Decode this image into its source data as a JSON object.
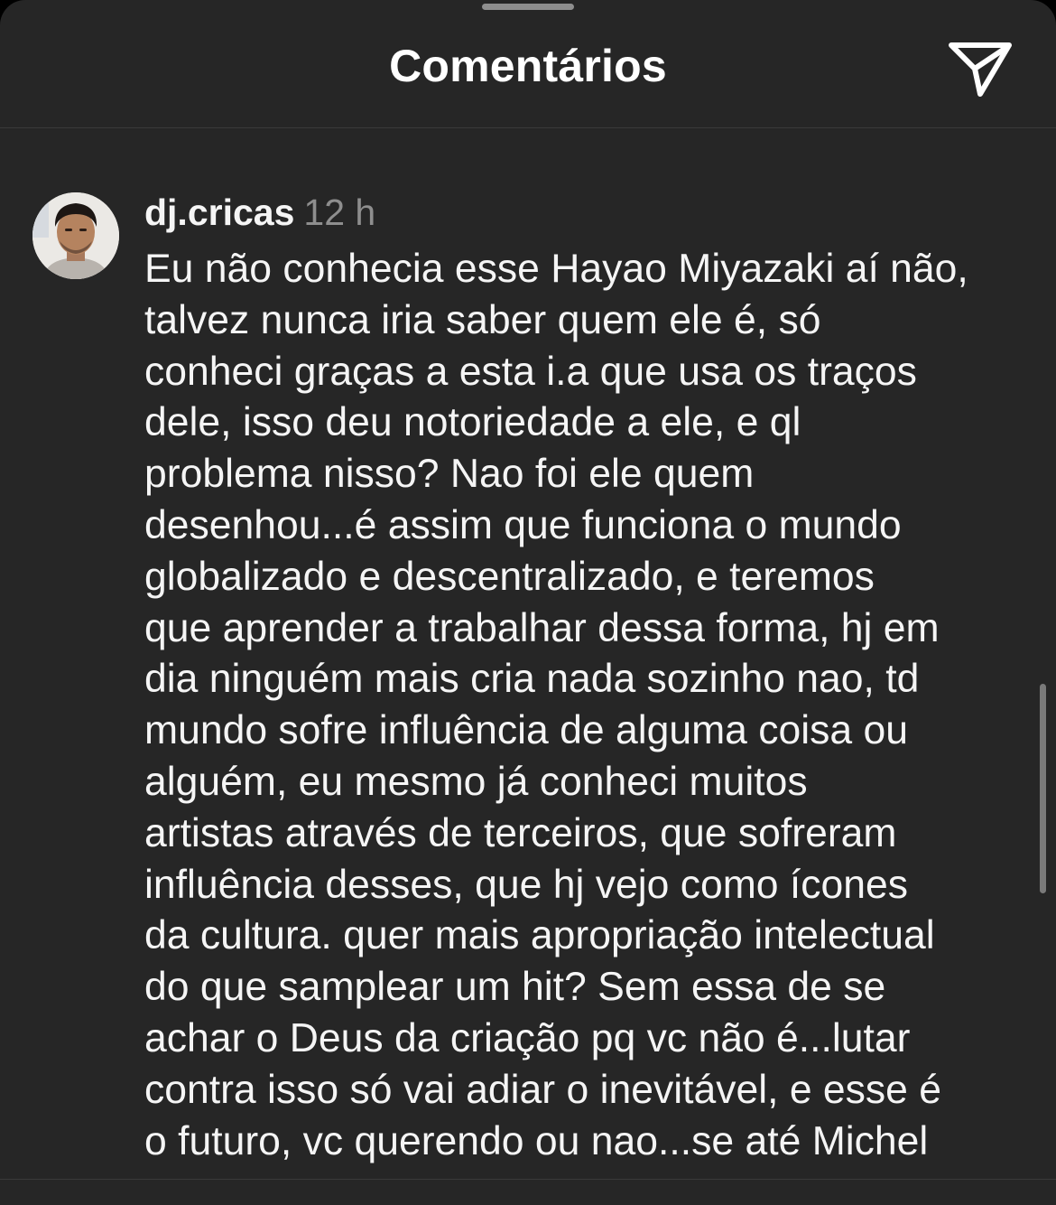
{
  "header": {
    "title": "Comentários",
    "share_icon": "paper-plane-icon"
  },
  "comment": {
    "username": "dj.cricas",
    "time": "12 h",
    "avatar_icon": "user-avatar-photo",
    "text": "Eu não conhecia esse Hayao Miyazaki aí não,\ntalvez nunca iria saber quem ele é, só\nconheci graças a esta i.a que usa os traços\ndele, isso deu notoriedade a ele, e ql\nproblema nisso? Nao foi ele quem\ndesenhou...é assim que funciona o mundo\nglobalizado e descentralizado, e teremos\nque aprender a trabalhar dessa forma, hj em\ndia ninguém mais cria nada sozinho nao, td\nmundo sofre influência de alguma coisa ou\nalguém, eu mesmo já conheci muitos\nartistas através de terceiros, que sofreram\ninfluência desses, que hj vejo como ícones\nda cultura. quer mais apropriação intelectual\ndo que samplear um hit? Sem essa de se\nachar o Deus da criação pq vc não é...lutar\ncontra isso só vai adiar o inevitável, e esse é\no futuro, vc querendo ou nao...se até Michel"
  },
  "colors": {
    "background": "#262626",
    "text_primary": "#f5f5f5",
    "text_secondary": "#8e8e8e",
    "divider": "#3a3a3a"
  }
}
